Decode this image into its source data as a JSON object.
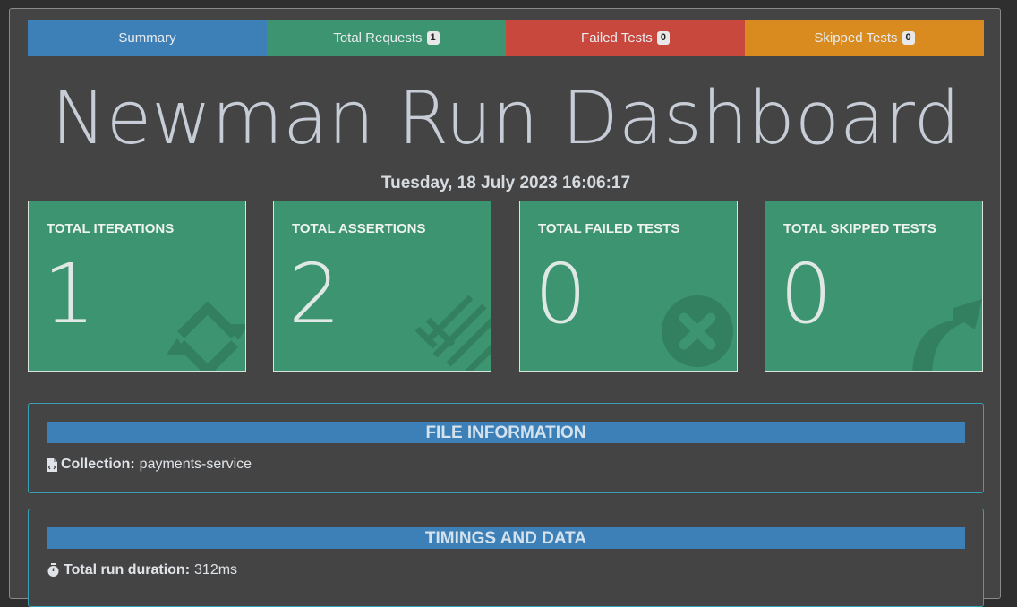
{
  "nav": {
    "tabs": [
      {
        "label": "Summary"
      },
      {
        "label": "Total Requests",
        "badge": "1"
      },
      {
        "label": "Failed Tests",
        "badge": "0"
      },
      {
        "label": "Skipped Tests",
        "badge": "0"
      }
    ]
  },
  "header": {
    "title": "Newman Run Dashboard",
    "timestamp": "Tuesday, 18 July 2023 16:06:17"
  },
  "cards": [
    {
      "label": "TOTAL ITERATIONS",
      "value": "1",
      "icon": "sync-icon"
    },
    {
      "label": "TOTAL ASSERTIONS",
      "value": "2",
      "icon": "stripes-icon"
    },
    {
      "label": "TOTAL FAILED TESTS",
      "value": "0",
      "icon": "x-circle-icon"
    },
    {
      "label": "TOTAL SKIPPED TESTS",
      "value": "0",
      "icon": "share-arrow-icon"
    }
  ],
  "file_info": {
    "heading": "FILE INFORMATION",
    "collection_label": "Collection:",
    "collection_value": "payments-service"
  },
  "timings": {
    "heading": "TIMINGS AND DATA",
    "duration_label": "Total run duration:",
    "duration_value": "312ms"
  },
  "colors": {
    "summary": "#3d80b7",
    "success": "#3c9470",
    "danger": "#c9483e",
    "warning": "#d98b20"
  }
}
